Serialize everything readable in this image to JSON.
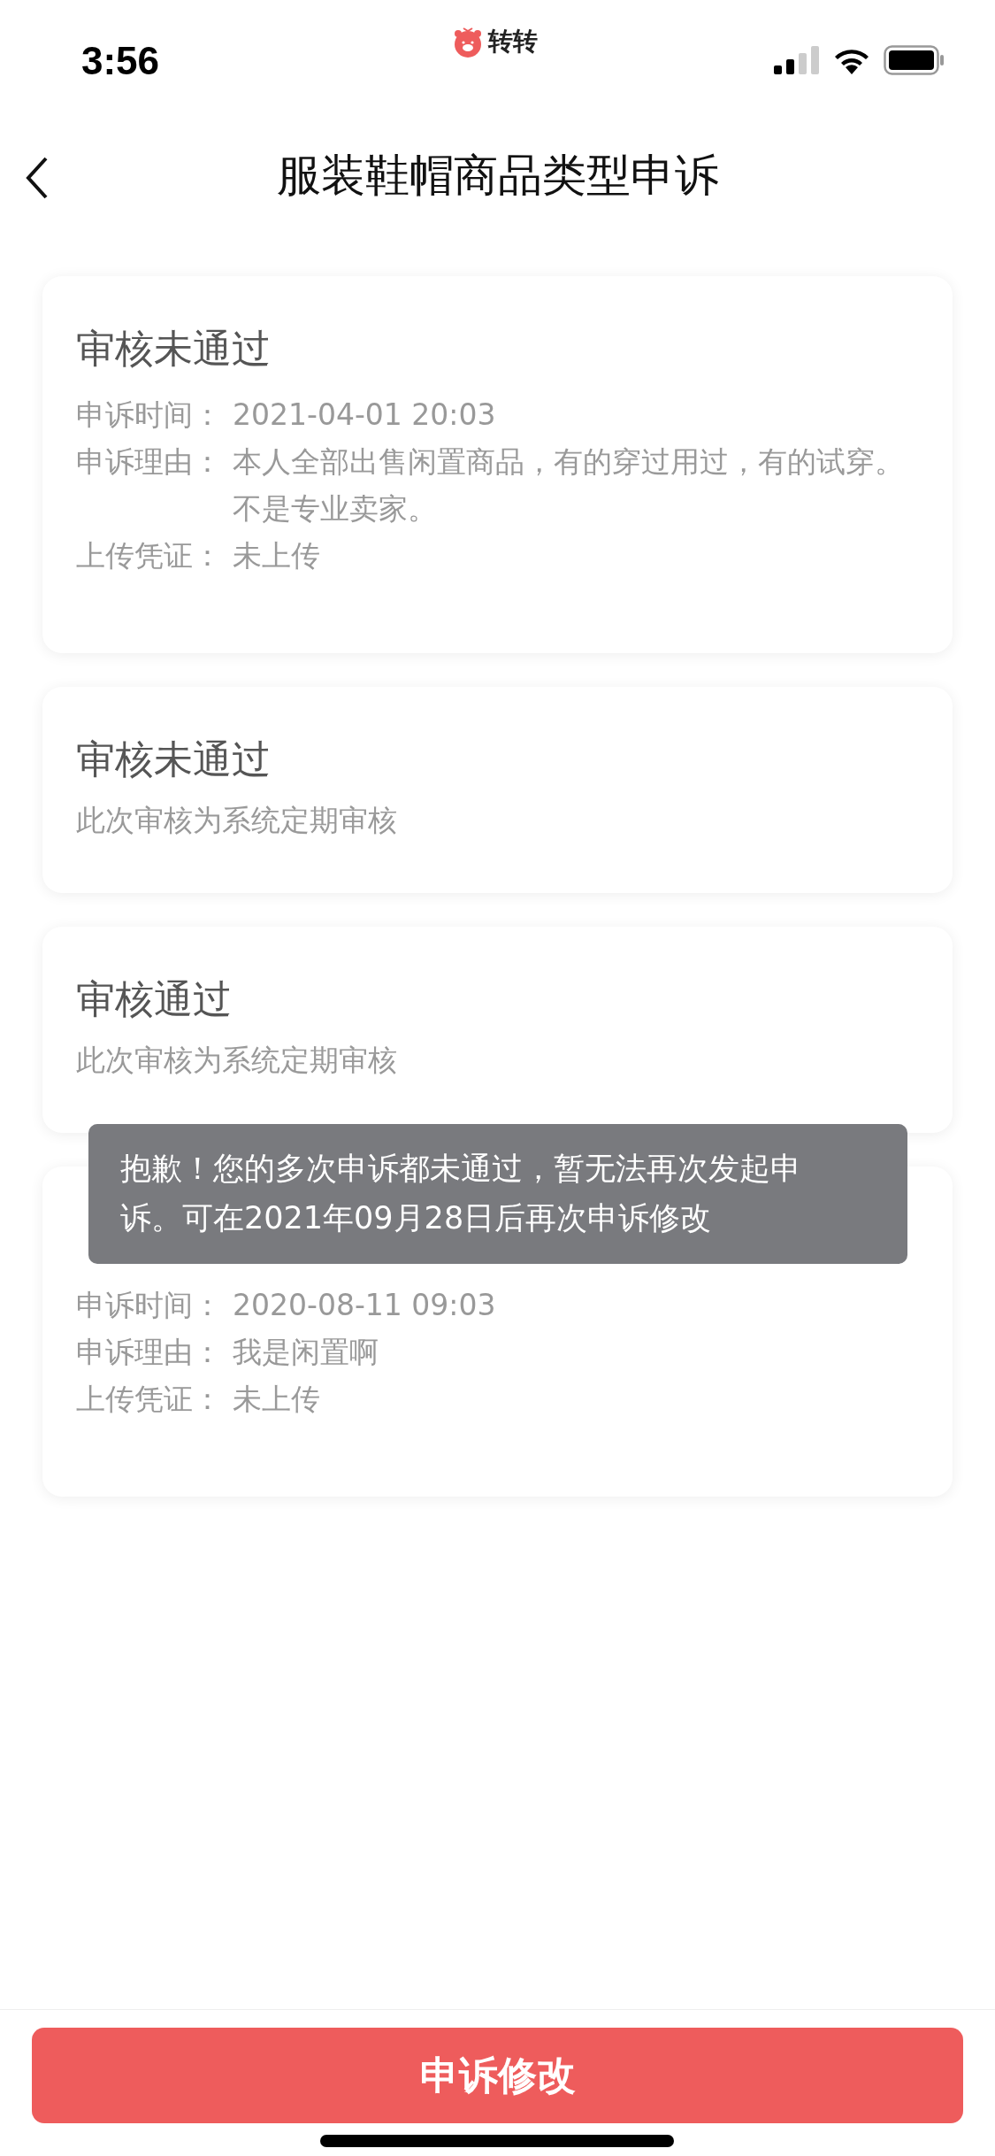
{
  "status_bar": {
    "time": "3:56",
    "app_name": "转转"
  },
  "header": {
    "title": "服装鞋帽商品类型申诉"
  },
  "records": [
    {
      "kind": "details",
      "title": "审核未通过",
      "fields": [
        {
          "label": "申诉时间：",
          "value": "2021-04-01 20:03"
        },
        {
          "label": "申诉理由：",
          "value": "本人全部出售闲置商品，有的穿过用过，有的试穿。不是专业卖家。"
        },
        {
          "label": "上传凭证：",
          "value": "未上传"
        }
      ]
    },
    {
      "kind": "note",
      "title": "审核未通过",
      "note": "此次审核为系统定期审核"
    },
    {
      "kind": "note",
      "title": "审核通过",
      "note": "此次审核为系统定期审核"
    },
    {
      "kind": "details",
      "fields": [
        {
          "label": "申诉时间：",
          "value": "2020-08-11 09:03"
        },
        {
          "label": "申诉理由：",
          "value": "我是闲置啊"
        },
        {
          "label": "上传凭证：",
          "value": "未上传"
        }
      ]
    }
  ],
  "toast": {
    "text": "抱歉！您的多次申诉都未通过，暂无法再次发起申诉。可在2021年09月28日后再次申诉修改"
  },
  "button": {
    "label": "申诉修改"
  }
}
